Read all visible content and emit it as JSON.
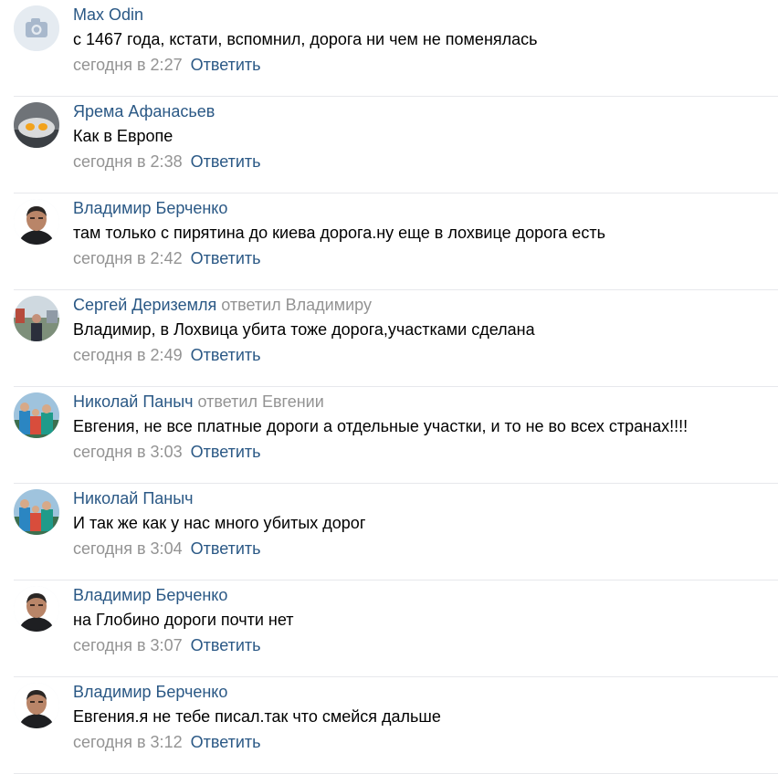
{
  "comments": [
    {
      "author": "Max Odin",
      "reply_to": "",
      "text": "с 1467 года, кстати, вспомнил, дорога ни чем не поменялась",
      "date": "сегодня в 2:27",
      "reply_label": "Ответить",
      "avatar": "camera-placeholder-icon"
    },
    {
      "author": "Ярема Афанасьев",
      "reply_to": "",
      "text": "Как в Европе",
      "date": "сегодня в 2:38",
      "reply_label": "Ответить",
      "avatar": "fried-egg-photo"
    },
    {
      "author": "Владимир Берченко",
      "reply_to": "",
      "text": "там только с пирятина до киева дорога.ну еще в лохвице дорога есть",
      "date": "сегодня в 2:42",
      "reply_label": "Ответить",
      "avatar": "man-portrait-photo"
    },
    {
      "author": "Сергей Дериземля",
      "reply_to": "ответил Владимиру",
      "text": "Владимир, в Лохвица убита тоже дорога,участками сделана",
      "date": "сегодня в 2:49",
      "reply_label": "Ответить",
      "avatar": "man-outdoors-photo"
    },
    {
      "author": "Николай Паныч",
      "reply_to": "ответил Евгении",
      "text": "Евгения, не все платные дороги а отдельные участки, и то не во всех странах!!!!",
      "date": "сегодня в 3:03",
      "reply_label": "Ответить",
      "avatar": "group-photo"
    },
    {
      "author": "Николай Паныч",
      "reply_to": "",
      "text": "И так же как у нас много убитых дорог",
      "date": "сегодня в 3:04",
      "reply_label": "Ответить",
      "avatar": "group-photo"
    },
    {
      "author": "Владимир Берченко",
      "reply_to": "",
      "text": "на Глобино дороги почти нет",
      "date": "сегодня в 3:07",
      "reply_label": "Ответить",
      "avatar": "man-portrait-photo"
    },
    {
      "author": "Владимир Берченко",
      "reply_to": "",
      "text": "Евгения.я не тебе писал.так что смейся дальше",
      "date": "сегодня в 3:12",
      "reply_label": "Ответить",
      "avatar": "man-portrait-photo"
    }
  ],
  "colors": {
    "link": "#2a5885",
    "meta": "#939393",
    "text": "#000000",
    "divider": "#e7e8ec",
    "avatar_placeholder": "#e5ebf1"
  }
}
